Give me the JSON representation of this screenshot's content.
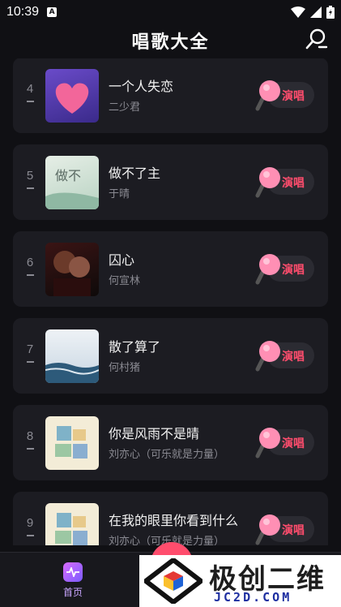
{
  "status": {
    "time": "10:39",
    "a_badge": "A"
  },
  "header": {
    "title": "唱歌大全"
  },
  "songs": [
    {
      "rank": "4",
      "title": "一个人失恋",
      "artist": "二少君",
      "action": "演唱"
    },
    {
      "rank": "5",
      "title": "做不了主",
      "artist": "于晴",
      "action": "演唱"
    },
    {
      "rank": "6",
      "title": "囚心",
      "artist": "何宣林",
      "action": "演唱"
    },
    {
      "rank": "7",
      "title": "散了算了",
      "artist": "何村猪",
      "action": "演唱"
    },
    {
      "rank": "8",
      "title": "你是风雨不是晴",
      "artist": "刘亦心（可乐就是力量）",
      "action": "演唱"
    },
    {
      "rank": "9",
      "title": "在我的眼里你看到什么",
      "artist": "刘亦心（可乐就是力量）",
      "action": "演唱"
    }
  ],
  "bottom_nav": {
    "home_label": "首页"
  },
  "watermark": {
    "text": "极创二维",
    "url": "JC2D.COM"
  },
  "colors": {
    "background": "#101014",
    "card": "#1c1c22",
    "accent": "#ff4d6d",
    "mic_pink": "#ff8fb4"
  }
}
